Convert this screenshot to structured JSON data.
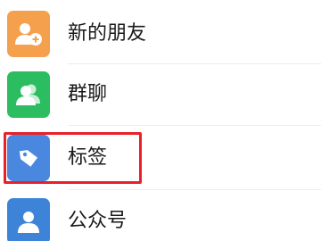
{
  "contacts_menu": {
    "items": [
      {
        "label": "新的朋友",
        "icon": "add-friend-icon",
        "color": "#f4a04d"
      },
      {
        "label": "群聊",
        "icon": "group-chat-icon",
        "color": "#2bbd5f"
      },
      {
        "label": "标签",
        "icon": "tag-icon",
        "color": "#4a88e0"
      },
      {
        "label": "公众号",
        "icon": "official-account-icon",
        "color": "#3d84d8"
      }
    ]
  },
  "highlight": {
    "target": "tag-row",
    "color": "#e8202a"
  }
}
